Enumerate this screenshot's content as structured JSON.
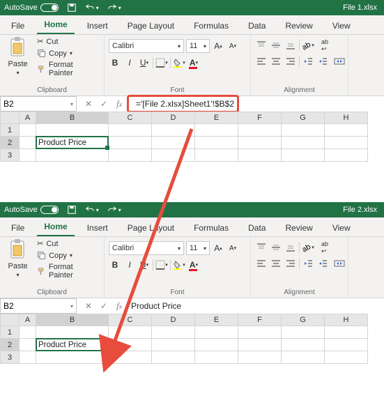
{
  "windowTop": {
    "filename": "File 1.xlsx",
    "autosave": "AutoSave",
    "tabs": {
      "file": "File",
      "home": "Home",
      "insert": "Insert",
      "pageLayout": "Page Layout",
      "formulas": "Formulas",
      "data": "Data",
      "review": "Review",
      "view": "View"
    },
    "clipboard": {
      "cut": "Cut",
      "copy": "Copy",
      "fp": "Format Painter",
      "paste": "Paste",
      "label": "Clipboard"
    },
    "font": {
      "name": "Calibri",
      "size": "11",
      "label": "Font"
    },
    "align": {
      "label": "Alignment"
    },
    "nameBox": "B2",
    "formula": "='[File 2.xlsx]Sheet1'!$B$2",
    "cols": [
      "A",
      "B",
      "C",
      "D",
      "E",
      "F",
      "G",
      "H"
    ],
    "rows": [
      "1",
      "2",
      "3"
    ],
    "b2": "Product Price"
  },
  "windowBot": {
    "filename": "File 2.xlsx",
    "autosave": "AutoSave",
    "tabs": {
      "file": "File",
      "home": "Home",
      "insert": "Insert",
      "pageLayout": "Page Layout",
      "formulas": "Formulas",
      "data": "Data",
      "review": "Review",
      "view": "View"
    },
    "clipboard": {
      "cut": "Cut",
      "copy": "Copy",
      "fp": "Format Painter",
      "paste": "Paste",
      "label": "Clipboard"
    },
    "font": {
      "name": "Calibri",
      "size": "11",
      "label": "Font"
    },
    "align": {
      "label": "Alignment"
    },
    "nameBox": "B2",
    "formula": "Product Price",
    "cols": [
      "A",
      "B",
      "C",
      "D",
      "E",
      "F",
      "G",
      "H"
    ],
    "rows": [
      "1",
      "2",
      "3"
    ],
    "b2": "Product Price"
  }
}
